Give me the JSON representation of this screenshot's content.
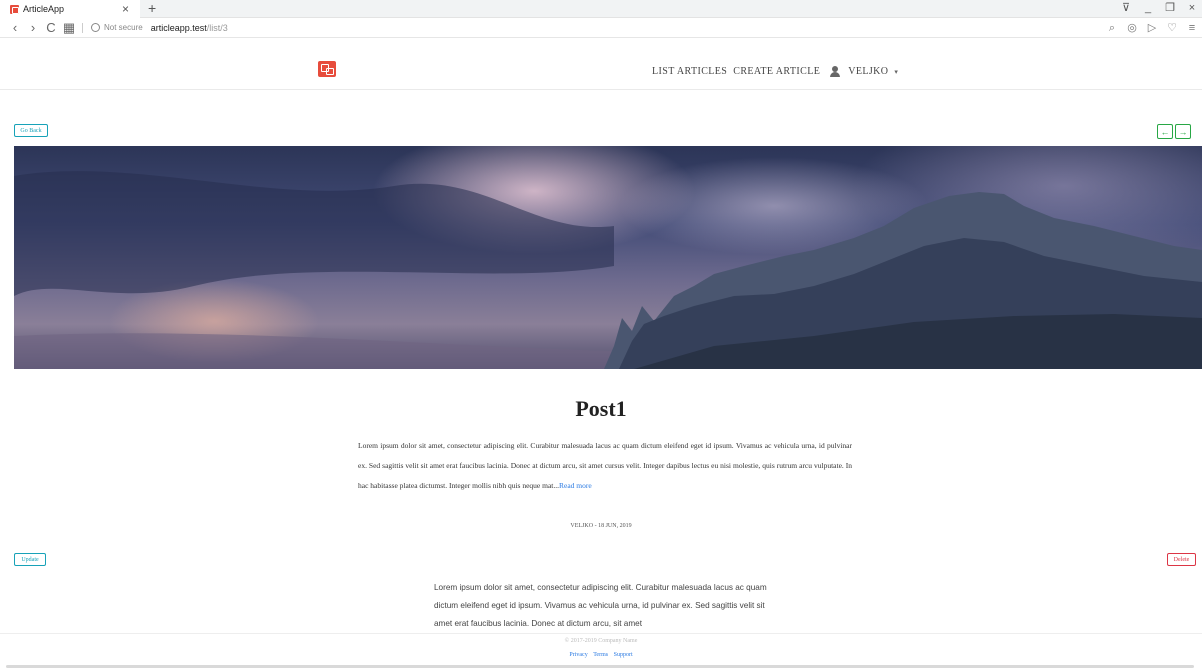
{
  "browser": {
    "tab_title": "ArticleApp",
    "tab_close": "×",
    "new_tab": "+",
    "security": "Not secure",
    "url_host": "articleapp.test",
    "url_path": "/list/3"
  },
  "nav": {
    "list_articles": "LIST ARTICLES",
    "create_article": "CREATE ARTICLE",
    "user": "VELJKO",
    "caret": "▾"
  },
  "actions": {
    "go_back": "Go Back",
    "prev": "←",
    "next": "→",
    "update": "Update",
    "delete": "Delete"
  },
  "post": {
    "title": "Post1",
    "excerpt": "Lorem ipsum dolor sit amet, consectetur adipiscing elit. Curabitur malesuada lacus ac quam dictum eleifend eget id ipsum. Vivamus ac vehicula urna, id pulvinar ex. Sed sagittis velit sit amet erat faucibus lacinia. Donec at dictum arcu, sit amet cursus velit. Integer dapibus lectus eu nisi molestie, quis rutrum arcu vulputate. In hac habitasse platea dictumst. Integer mollis nibh quis neque mat...",
    "read_more": "Read more",
    "meta": "VELJKO - 18 JUN, 2019",
    "full_body": "Lorem ipsum dolor sit amet, consectetur adipiscing elit. Curabitur malesuada lacus ac quam dictum eleifend eget id ipsum. Vivamus ac vehicula urna, id pulvinar ex. Sed sagittis velit sit amet erat faucibus lacinia. Donec at dictum arcu, sit amet"
  },
  "footer": {
    "copyright": "© 2017-2019 Company Name",
    "links": [
      "Privacy",
      "Terms",
      "Support"
    ]
  },
  "icons": {
    "back": "‹",
    "forward": "›",
    "reload": "C",
    "grid": "▦",
    "search": "⌕",
    "camera": "◎",
    "send": "▷",
    "heart": "♡",
    "menu": "≡",
    "filter": "⊽",
    "minimize": "_",
    "restore": "❐",
    "close": "×"
  }
}
